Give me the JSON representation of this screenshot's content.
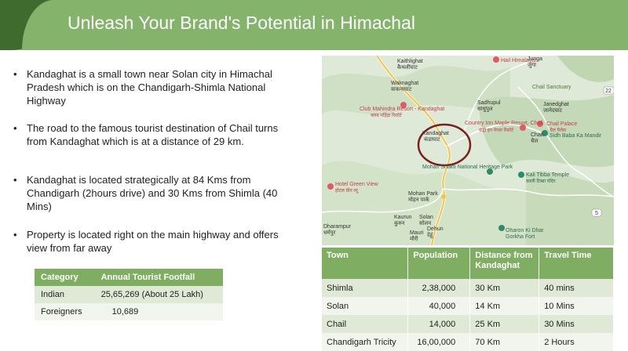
{
  "title": "Unleash Your Brand's Potential in Himachal",
  "bullets": [
    "Kandaghat is a small town near Solan city in Himachal Pradesh which is on the Chandigarh-Shimla National Highway",
    "The road to the famous tourist destination of Chail turns from Kandaghat which is at a distance of 29 km.",
    "Kandaghat is located strategically at 84 Kms from Chandigarh (2hours drive) and 30 Kms from Shimla (40 Mins)",
    "Property is located right on the main highway and offers view from far away"
  ],
  "footfall": {
    "headers": [
      "Category",
      "Annual Tourist Footfall"
    ],
    "rows": [
      [
        "Indian",
        "25,65,269 (About 25 Lakh)"
      ],
      [
        "Foreigners",
        "10,689"
      ]
    ]
  },
  "map": {
    "labels": {
      "kaithlighat": "Kaithlighat",
      "kaithlighat_hi": "कैथलीघाट",
      "hail_himalayan": "Hail Himalayan",
      "junga": "Junga",
      "junga_hi": "जुंगा",
      "chail_sanctuary": "Chail Sanctuary",
      "waknaghat": "Waknaghat",
      "waknaghat_hi": "वाकनाघाट",
      "sadhupul": "Sadhupul",
      "sadhupul_hi": "साधुपुल",
      "janedghat": "Janedghat",
      "janedghat_hi": "जानेदघाट",
      "club_mahindra": "Club Mahindra Resort - Kandaghat",
      "club_mahindra_hi": "क्लब महिंद्रा रिसॉर्ट",
      "country_inn": "Country Inn Maple Resort, Chail",
      "country_inn_hi": "कंट्री इन मेपल रिसॉर्ट",
      "chail_palace": "Chail Palace",
      "chail_palace_hi": "चैल पैलेस",
      "kandaghat": "Kandaghat",
      "kandaghat_hi": "कंडाघाट",
      "chail": "Chail",
      "chail_hi": "चैल",
      "sidh_baba": "Sidh Baba Ka Mandir",
      "mohan_shakti": "Mohan Shakti National Heritage Park",
      "kali_tibba": "Kali Tibba Temple",
      "kali_tibba_hi": "काली टिब्बा मंदिर",
      "hotel_green_view": "Hotel Green View",
      "hotel_green_view_hi": "होटल ग्रीन व्यू",
      "mohan_park": "Mohan Park",
      "mohan_park_hi": "मोहन पार्क",
      "kaurun": "Kaurun",
      "kaurun_hi": "कुरुन",
      "solan": "Solan",
      "solan_hi": "सोलन",
      "dehun": "Dehun",
      "dehun_hi": "देहूं",
      "dharampur": "Dharampur",
      "dharampur_hi": "धर्मपुर",
      "mauri": "Mauri",
      "mauri_hi": "मौरी",
      "oharon": "Oharon Ki Dhar",
      "gorkha_fort": "Gorkha Fort",
      "road_5": "5",
      "road_22": "22"
    }
  },
  "towns": {
    "headers": [
      "Town",
      "Population",
      "Distance from Kandaghat",
      "Travel Time"
    ],
    "rows": [
      [
        "Shimla",
        "2,38,000",
        "30 Km",
        "40 mins"
      ],
      [
        "Solan",
        "40,000",
        "14 Km",
        "10 Mins"
      ],
      [
        "Chail",
        "14,000",
        "25 Km",
        "30 Mins"
      ],
      [
        "Chandigarh Tricity",
        "16,00,000",
        "70 Km",
        "2 Hours"
      ]
    ]
  }
}
